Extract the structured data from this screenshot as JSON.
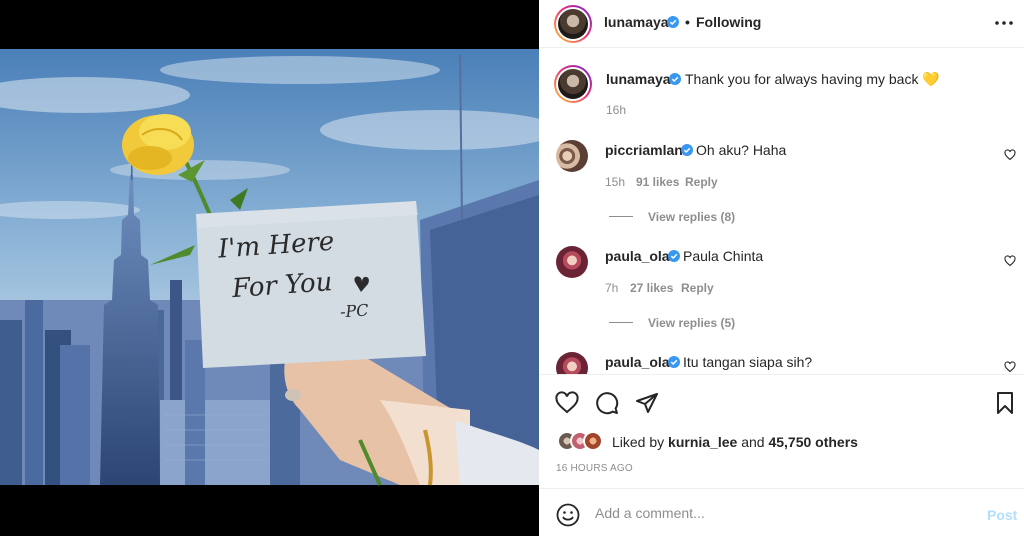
{
  "header": {
    "username": "lunamaya",
    "separator": "•",
    "follow_status": "Following",
    "more_icon": "more-horizontal-icon"
  },
  "photo": {
    "note_line1": "I'm Here",
    "note_line2": "For You",
    "note_signature": "-PC"
  },
  "caption": {
    "username": "lunamaya",
    "text": "Thank you for always having my back 💛",
    "time": "16h"
  },
  "comments": [
    {
      "username": "piccriamlan",
      "text": "Oh aku? Haha",
      "time": "15h",
      "likes": "91 likes",
      "reply": "Reply",
      "view_replies": "View replies (8)"
    },
    {
      "username": "paula_ola",
      "text": "Paula Chinta",
      "time": "7h",
      "likes": "27 likes",
      "reply": "Reply",
      "view_replies": "View replies (5)"
    },
    {
      "username": "paula_ola",
      "text": "Itu tangan siapa sih?"
    }
  ],
  "likes": {
    "prefix": "Liked by",
    "user": "kurnia_lee",
    "middle": "and",
    "others": "45,750 others"
  },
  "timestamp": "16 HOURS AGO",
  "add_comment": {
    "placeholder": "Add a comment...",
    "post_label": "Post"
  },
  "colors": {
    "verified": "#3897f0",
    "muted": "#8e8e8e",
    "post_disabled": "#b2dffc",
    "text": "#262626"
  }
}
